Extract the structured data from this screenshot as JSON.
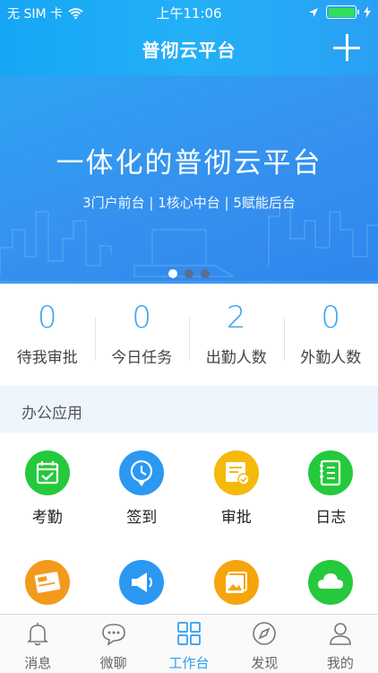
{
  "status_bar": {
    "carrier": "无 SIM 卡",
    "time": "上午11:06"
  },
  "nav": {
    "title": "普彻云平台"
  },
  "banner": {
    "title": "一体化的普彻云平台",
    "subtitle": "3门户前台 | 1核心中台 | 5赋能后台",
    "dots_total": 3,
    "active_dot": 0
  },
  "stats": [
    {
      "value": "0",
      "label": "待我审批"
    },
    {
      "value": "0",
      "label": "今日任务"
    },
    {
      "value": "2",
      "label": "出勤人数"
    },
    {
      "value": "0",
      "label": "外勤人数"
    }
  ],
  "section": {
    "title": "办公应用"
  },
  "apps": [
    {
      "label": "考勤",
      "icon": "calendar-check-icon",
      "color": "#25c93c"
    },
    {
      "label": "签到",
      "icon": "clock-pin-icon",
      "color": "#2b98f2"
    },
    {
      "label": "审批",
      "icon": "document-approve-icon",
      "color": "#f5b90c"
    },
    {
      "label": "日志",
      "icon": "notebook-icon",
      "color": "#25c93c"
    },
    {
      "label": "",
      "icon": "news-icon",
      "color": "#f39a1c"
    },
    {
      "label": "",
      "icon": "megaphone-icon",
      "color": "#2b98f2"
    },
    {
      "label": "",
      "icon": "gallery-icon",
      "color": "#f5a40c"
    },
    {
      "label": "",
      "icon": "cloud-icon",
      "color": "#25c93c"
    }
  ],
  "tabs": [
    {
      "label": "消息",
      "icon": "bell-icon"
    },
    {
      "label": "微聊",
      "icon": "chat-icon"
    },
    {
      "label": "工作台",
      "icon": "grid-icon",
      "active": true
    },
    {
      "label": "发现",
      "icon": "compass-icon"
    },
    {
      "label": "我的",
      "icon": "person-icon"
    }
  ]
}
